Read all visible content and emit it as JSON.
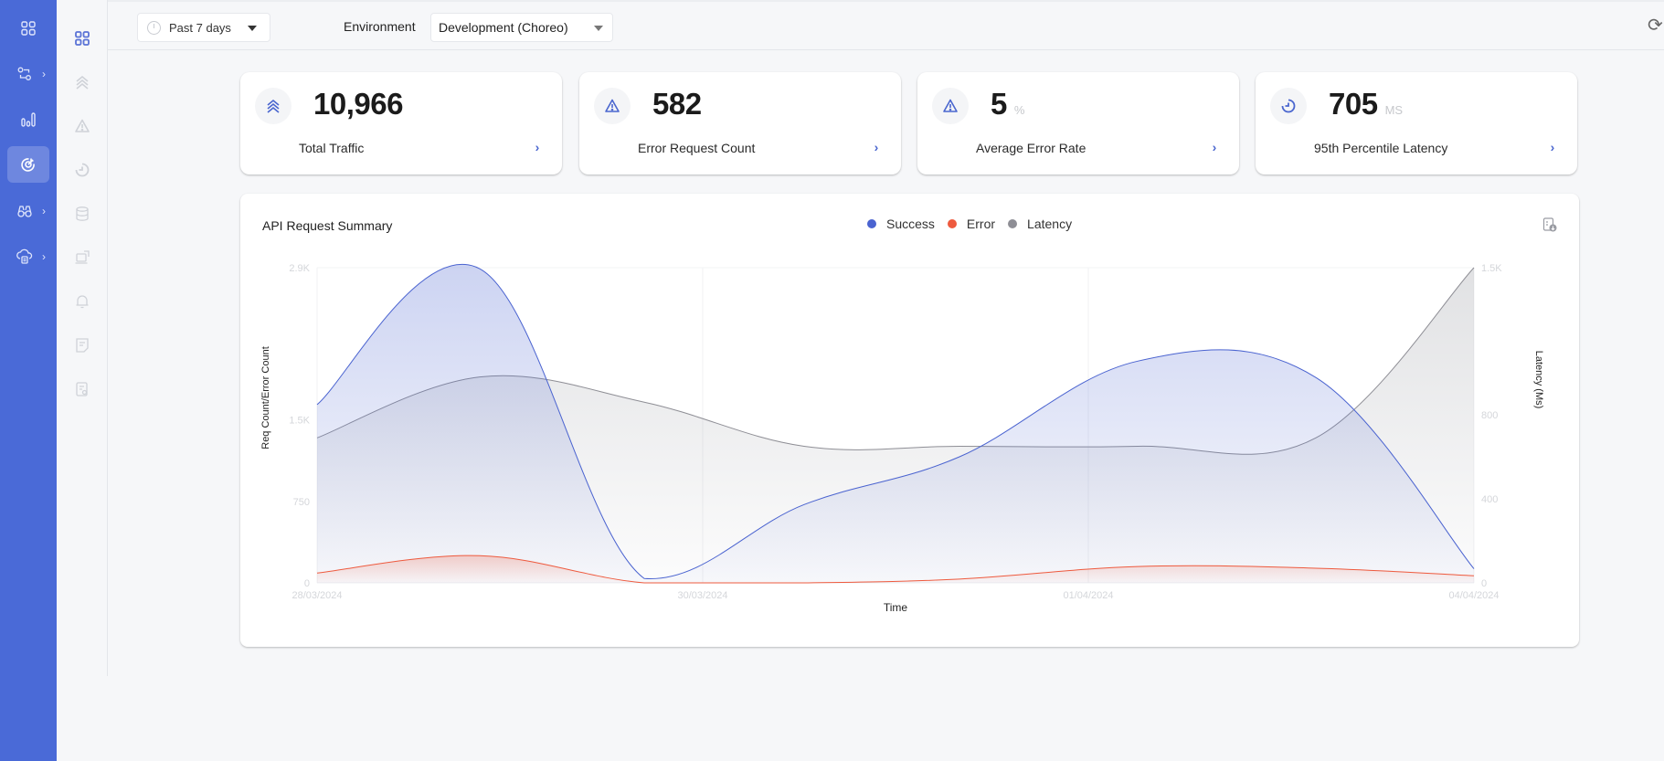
{
  "nav": {
    "rail": [
      {
        "icon": "dashboard-grid-icon",
        "has_submenu": false,
        "active": false
      },
      {
        "icon": "integration-flow-icon",
        "has_submenu": true,
        "active": false
      },
      {
        "icon": "bar-chart-icon",
        "has_submenu": false,
        "active": false
      },
      {
        "icon": "target-icon",
        "has_submenu": false,
        "active": true
      },
      {
        "icon": "binoculars-icon",
        "has_submenu": true,
        "active": false
      },
      {
        "icon": "cloud-settings-icon",
        "has_submenu": true,
        "active": false
      }
    ],
    "chevron": "›",
    "sub": [
      {
        "icon": "overview-grid-icon",
        "active": true
      },
      {
        "icon": "traffic-icon",
        "active": false
      },
      {
        "icon": "warning-icon",
        "active": false
      },
      {
        "icon": "latency-clock-icon",
        "active": false
      },
      {
        "icon": "database-icon",
        "active": false
      },
      {
        "icon": "device-icon",
        "active": false
      },
      {
        "icon": "bell-icon",
        "active": false
      },
      {
        "icon": "log-document-icon",
        "active": false
      },
      {
        "icon": "report-settings-icon",
        "active": false
      }
    ]
  },
  "toolbar": {
    "time_range": "Past 7 days",
    "environment_label": "Environment",
    "environment_value": "Development (Choreo)",
    "refresh_glyph": "⟳"
  },
  "cards": [
    {
      "icon": "traffic-icon",
      "value": "10,966",
      "unit": "",
      "label": "Total Traffic",
      "arrow": "›"
    },
    {
      "icon": "warning-icon",
      "value": "582",
      "unit": "",
      "label": "Error Request Count",
      "arrow": "›"
    },
    {
      "icon": "warning-icon",
      "value": "5",
      "unit": "%",
      "label": "Average Error Rate",
      "arrow": "›"
    },
    {
      "icon": "latency-clock-icon",
      "value": "705",
      "unit": "MS",
      "label": "95th Percentile Latency",
      "arrow": "›"
    }
  ],
  "colors": {
    "accent": "#4a6ad7",
    "success": "#4a63d0",
    "error": "#ee5a3e",
    "latency": "#8e8e95"
  },
  "chart_data": {
    "type": "area",
    "title": "API Request Summary",
    "xlabel": "Time",
    "ylabel": "Req Count/Error Count",
    "y2label": "Latency (Ms)",
    "x_tick_labels": [
      "28/03/2024",
      "30/03/2024",
      "01/04/2024",
      "04/04/2024"
    ],
    "y_ticks": [
      "0",
      "750",
      "1.5K",
      "2.9K"
    ],
    "y_tick_values": [
      0,
      750,
      1500,
      2900
    ],
    "y2_ticks": [
      "0",
      "400",
      "800",
      "1.5K"
    ],
    "y2_tick_values": [
      0,
      400,
      800,
      1500
    ],
    "ylim": [
      0,
      2900
    ],
    "y2lim": [
      0,
      1500
    ],
    "grid": true,
    "legend_position": "top-center",
    "series": [
      {
        "name": "Success",
        "axis": "left",
        "values": [
          1640,
          2890,
          40,
          720,
          1160,
          2040,
          1890,
          130
        ]
      },
      {
        "name": "Error",
        "axis": "left",
        "values": [
          90,
          250,
          0,
          0,
          35,
          150,
          135,
          65
        ]
      },
      {
        "name": "Latency",
        "axis": "right",
        "values": [
          690,
          980,
          860,
          650,
          650,
          650,
          690,
          1500
        ]
      }
    ],
    "x_positions": [
      0,
      0.1406,
      0.2828,
      0.421,
      0.5553,
      0.7093,
      0.8633,
      1.0
    ]
  }
}
